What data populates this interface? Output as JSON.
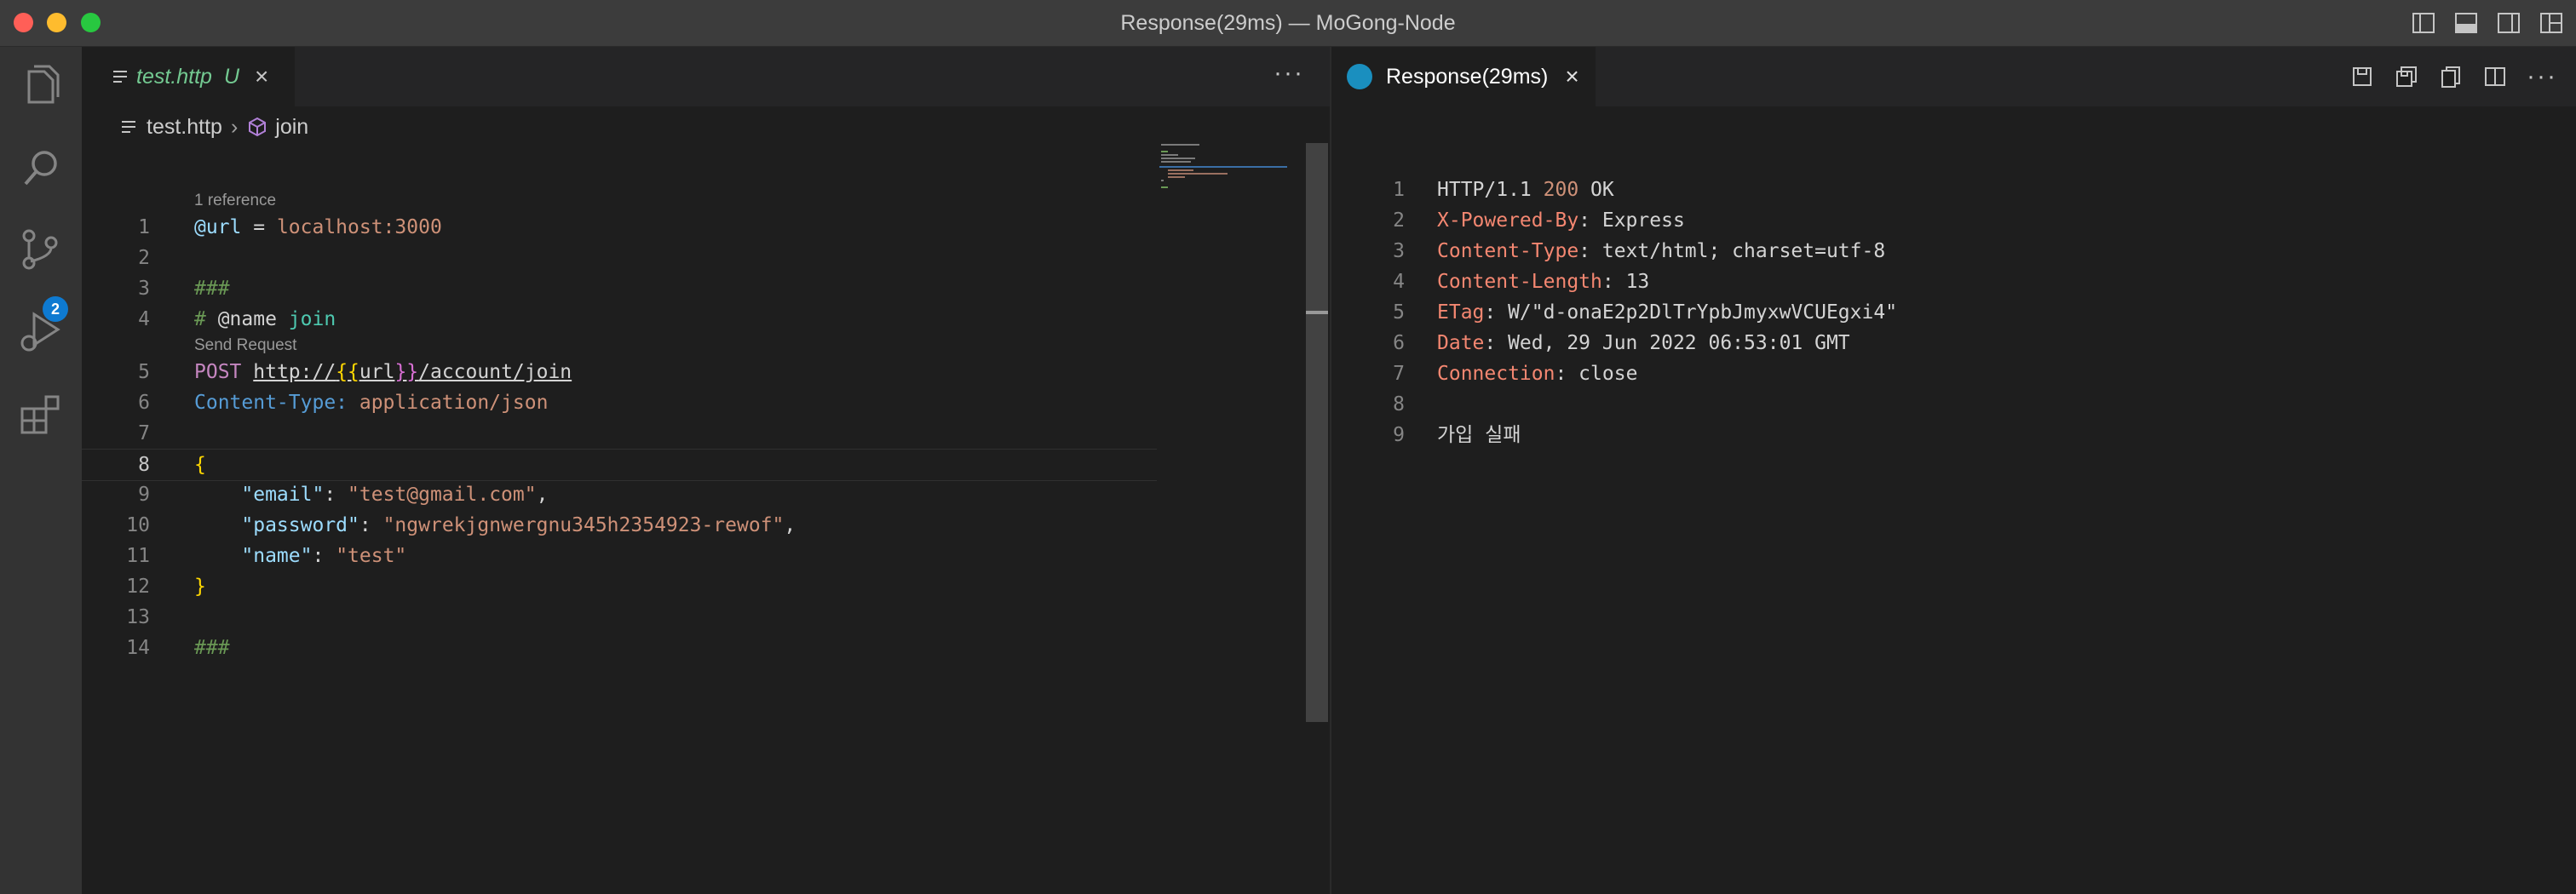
{
  "window": {
    "title": "Response(29ms) — MoGong-Node"
  },
  "activity": {
    "scm_badge": "2"
  },
  "left_editor": {
    "tab": {
      "name": "test.http",
      "status": "U"
    },
    "more": "···",
    "breadcrumb": {
      "file": "test.http",
      "symbol": "join"
    },
    "lenses": {
      "reference": "1 reference",
      "send": "Send Request"
    },
    "lines": {
      "n1": "1",
      "n2": "2",
      "n3": "3",
      "n4": "4",
      "n5": "5",
      "n6": "6",
      "n7": "7",
      "n8": "8",
      "n9": "9",
      "n10": "10",
      "n11": "11",
      "n12": "12",
      "n13": "13",
      "n14": "14",
      "l1_var": "@url",
      "l1_eq": " = ",
      "l1_val": "localhost:3000",
      "l3": "###",
      "l4_hash": "# ",
      "l4_kw": "@name",
      "l4_name": " join",
      "l5_method": "POST",
      "l5_url_pre": "http://",
      "l5_brace_open": "{{",
      "l5_var": "url",
      "l5_brace_close": "}}",
      "l5_url_post": "/account/join",
      "l6_head": "Content-Type:",
      "l6_val": " application/json",
      "l8": "{",
      "l9_key": "\"email\"",
      "l9_colon": ": ",
      "l9_val": "\"test@gmail.com\"",
      "l9_comma": ",",
      "l10_key": "\"password\"",
      "l10_colon": ": ",
      "l10_val": "\"ngwrekjgnwergnu345h2354923-rewof\"",
      "l10_comma": ",",
      "l11_key": "\"name\"",
      "l11_colon": ": ",
      "l11_val": "\"test\"",
      "l12": "}",
      "l14": "###"
    }
  },
  "right_editor": {
    "tab": {
      "name": "Response(29ms)"
    },
    "more": "···",
    "lines": {
      "n1": "1",
      "n2": "2",
      "n3": "3",
      "n4": "4",
      "n5": "5",
      "n6": "6",
      "n7": "7",
      "n8": "8",
      "n9": "9",
      "r1_proto": "HTTP/1.1 ",
      "r1_code": "200",
      "r1_msg": " OK",
      "r2_name": "X-Powered-By",
      "r2_val": ": Express",
      "r3_name": "Content-Type",
      "r3_val": ": text/html; charset=utf-8",
      "r4_name": "Content-Length",
      "r4_val": ": 13",
      "r5_name": "ETag",
      "r5_val": ": W/\"d-onaE2p2DlTrYpbJmyxwVCUEgxi4\"",
      "r6_name": "Date",
      "r6_val": ": Wed, 29 Jun 2022 06:53:01 GMT",
      "r7_name": "Connection",
      "r7_val": ": close",
      "r9": "가입 실패"
    }
  }
}
